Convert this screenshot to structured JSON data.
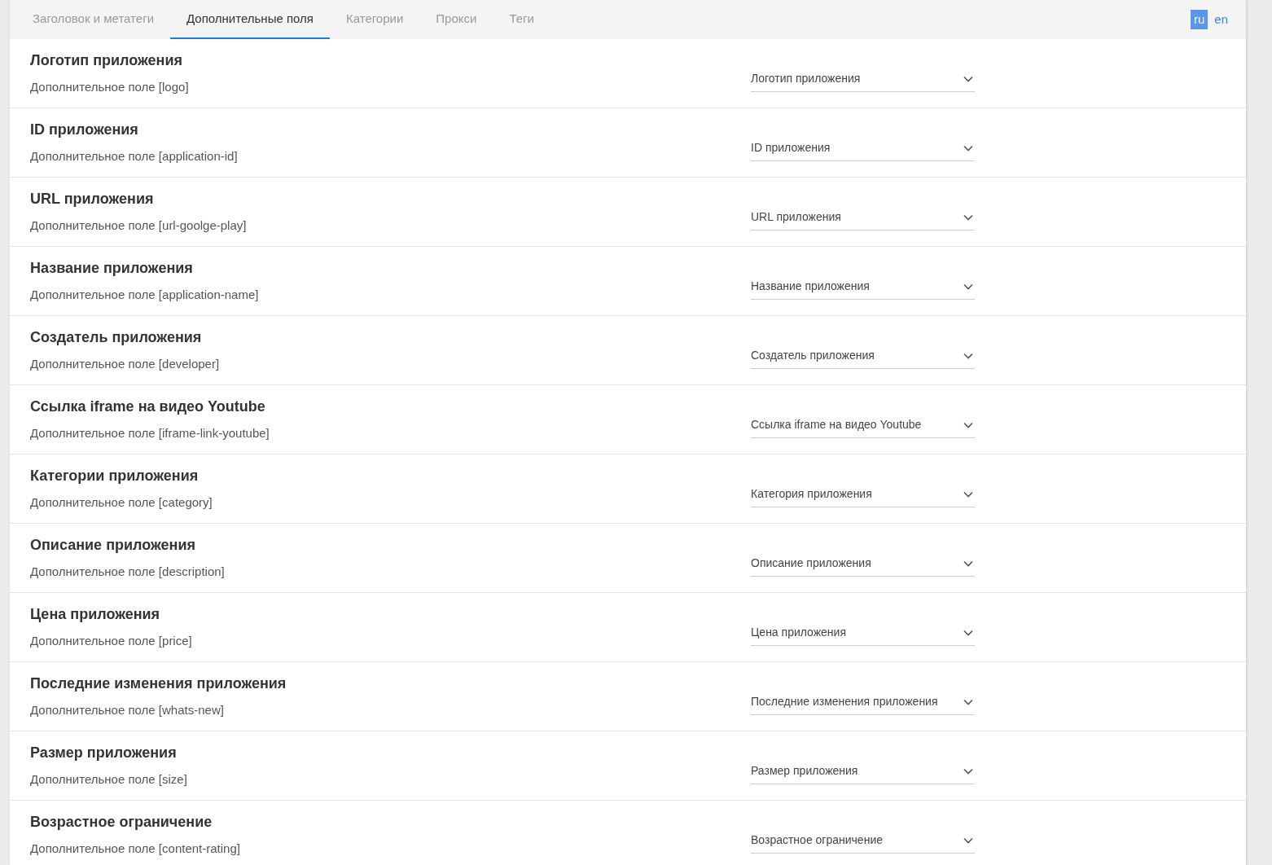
{
  "tabs": [
    {
      "label": "Заголовок и метатеги",
      "selected": false
    },
    {
      "label": "Дополнительные поля",
      "selected": true
    },
    {
      "label": "Категории",
      "selected": false
    },
    {
      "label": "Прокси",
      "selected": false
    },
    {
      "label": "Теги",
      "selected": false
    }
  ],
  "languages": [
    {
      "label": "ru",
      "selected": true
    },
    {
      "label": "en",
      "selected": false
    }
  ],
  "fields": [
    {
      "title": "Логотип приложения",
      "subtitle": "Дополнительное поле [logo]",
      "value": "Логотип приложения"
    },
    {
      "title": "ID приложения",
      "subtitle": "Дополнительное поле [application-id]",
      "value": "ID приложения"
    },
    {
      "title": "URL приложения",
      "subtitle": "Дополнительное поле [url-goolge-play]",
      "value": "URL приложения"
    },
    {
      "title": "Название приложения",
      "subtitle": "Дополнительное поле [application-name]",
      "value": "Название приложения"
    },
    {
      "title": "Создатель приложения",
      "subtitle": "Дополнительное поле [developer]",
      "value": "Создатель приложения"
    },
    {
      "title": "Ссылка iframe на видео Youtube",
      "subtitle": "Дополнительное поле [iframe-link-youtube]",
      "value": "Ссылка iframe на видео Youtube"
    },
    {
      "title": "Категории приложения",
      "subtitle": "Дополнительное поле [category]",
      "value": "Категория приложения"
    },
    {
      "title": "Описание приложения",
      "subtitle": "Дополнительное поле [description]",
      "value": "Описание приложения"
    },
    {
      "title": "Цена приложения",
      "subtitle": "Дополнительное поле [price]",
      "value": "Цена приложения"
    },
    {
      "title": "Последние изменения приложения",
      "subtitle": "Дополнительное поле [whats-new]",
      "value": "Последние изменения приложения"
    },
    {
      "title": "Размер приложения",
      "subtitle": "Дополнительное поле [size]",
      "value": "Размер приложения"
    },
    {
      "title": "Возрастное ограничение",
      "subtitle": "Дополнительное поле [content-rating]",
      "value": "Возрастное ограничение"
    }
  ]
}
